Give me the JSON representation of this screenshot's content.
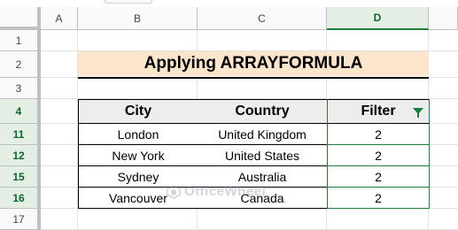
{
  "columns": [
    "A",
    "B",
    "C",
    "D"
  ],
  "rows": [
    "1",
    "2",
    "3",
    "4",
    "11",
    "12",
    "15",
    "16",
    "17"
  ],
  "title": "Applying ARRAYFORMULA",
  "table": {
    "headers": [
      "City",
      "Country",
      "Filter"
    ],
    "rows": [
      [
        "London",
        "United Kingdom",
        "2"
      ],
      [
        "New York",
        "United States",
        "2"
      ],
      [
        "Sydney",
        "Australia",
        "2"
      ],
      [
        "Vancouver",
        "Canada",
        "2"
      ]
    ]
  },
  "watermark": "OfficeWheel",
  "colors": {
    "title_bg": "#fce5cd",
    "header_bg": "#ededed",
    "selection": "#188038"
  }
}
